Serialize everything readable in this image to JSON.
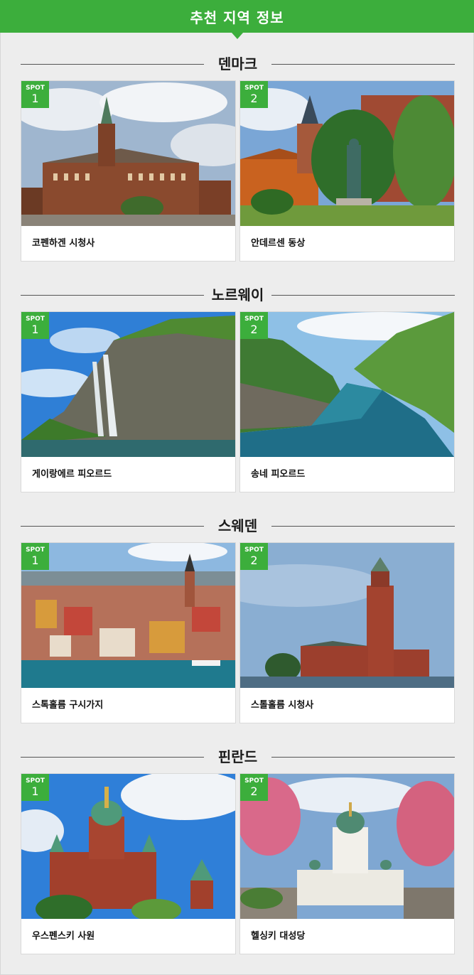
{
  "header": {
    "title": "추천 지역 정보"
  },
  "spot_label": "SPOT",
  "sections": [
    {
      "country": "덴마크",
      "spots": [
        {
          "num": "1",
          "name": "코펜하겐 시청사",
          "image": "copenhagen-city-hall-photo"
        },
        {
          "num": "2",
          "name": "안데르센 동상",
          "image": "andersen-statue-photo"
        }
      ]
    },
    {
      "country": "노르웨이",
      "spots": [
        {
          "num": "1",
          "name": "게이랑에르 피오르드",
          "image": "geirangerfjord-photo"
        },
        {
          "num": "2",
          "name": "송네 피오르드",
          "image": "sognefjord-photo"
        }
      ]
    },
    {
      "country": "스웨덴",
      "spots": [
        {
          "num": "1",
          "name": "스톡홀름 구시가지",
          "image": "stockholm-old-town-photo"
        },
        {
          "num": "2",
          "name": "스톨홀름 시청사",
          "image": "stockholm-city-hall-photo"
        }
      ]
    },
    {
      "country": "핀란드",
      "spots": [
        {
          "num": "1",
          "name": "우스펜스키 사원",
          "image": "uspenski-cathedral-photo"
        },
        {
          "num": "2",
          "name": "헬싱키 대성당",
          "image": "helsinki-cathedral-photo"
        }
      ]
    }
  ],
  "colors": {
    "accent": "#3cae3c",
    "background": "#ededed",
    "card": "#ffffff"
  }
}
